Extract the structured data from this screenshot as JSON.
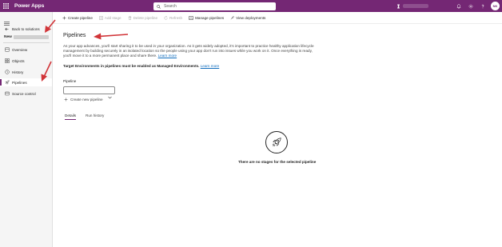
{
  "topbar": {
    "brand": "Power Apps",
    "search_placeholder": "Search",
    "avatar_initials": "NK"
  },
  "leftnav": {
    "back_label": "Back to solutions",
    "app_name": "New",
    "items": [
      {
        "label": "Overview",
        "icon": "overview-icon"
      },
      {
        "label": "Objects",
        "icon": "objects-icon"
      },
      {
        "label": "History",
        "icon": "history-icon"
      },
      {
        "label": "Pipelines",
        "icon": "pipelines-icon",
        "active": true
      },
      {
        "label": "Source control",
        "icon": "source-control-icon"
      }
    ]
  },
  "commandbar": {
    "create_pipeline": "Create pipeline",
    "add_stage": "Add stage",
    "delete_pipeline": "Delete pipeline",
    "refresh": "Refresh",
    "manage_pipelines": "Manage pipelines",
    "view_deployments": "View deployments"
  },
  "main": {
    "title": "Pipelines",
    "description": "As your app advances, you'll start sharing it to be used in your organization. As it gets widely adopted, it's important to practice healthy application lifecycle management by building securely in an isolated location so the people using your app don't run into issues while you work on it. Once everything is ready, you'll move it to a more permanent place and share there.",
    "learn_more": "Learn more",
    "note": "Target Environments in pipelines must be enabled as Managed Environments.",
    "note_link": "Learn more",
    "pipeline_label": "Pipeline",
    "new_pipeline": "Create new pipeline",
    "tabs": [
      "Details",
      "Run history"
    ],
    "empty_text": "There are no stages for the selected pipeline"
  },
  "colors": {
    "accent": "#742774",
    "link": "#0f6cbd",
    "annotation": "#d13438"
  }
}
